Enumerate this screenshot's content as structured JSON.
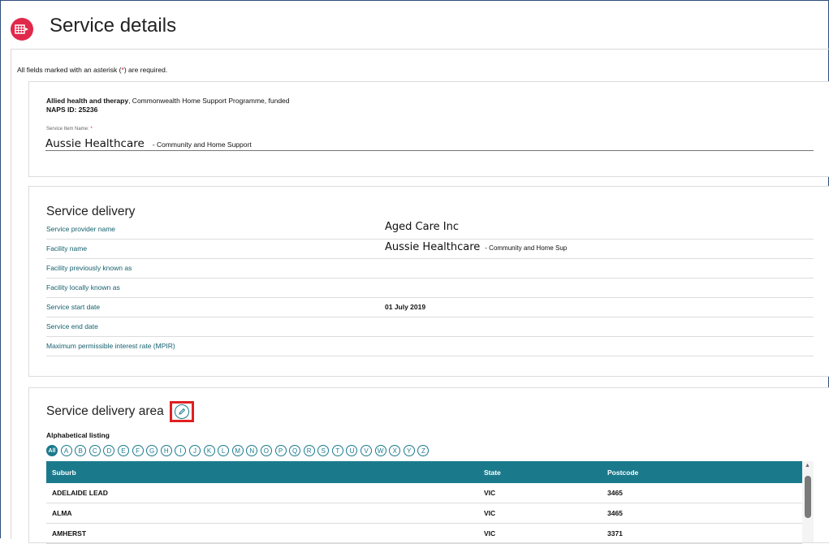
{
  "page": {
    "title": "Service details",
    "required_note_pre": "All fields marked with an asterisk (",
    "required_note_star": "*",
    "required_note_post": ") are required."
  },
  "service": {
    "type_bold": "Allied health and therapy",
    "type_rest": ", Commonwealth Home Support Programme, funded",
    "naps": "NAPS ID: 25236",
    "item_name_label": "Service Item Name:",
    "item_name_star": "*",
    "item_name_main": "Aussie Healthcare",
    "item_name_suffix": "- Community and Home Support"
  },
  "delivery": {
    "title": "Service delivery",
    "rows": [
      {
        "label": "Service provider name",
        "value": "Aged Care Inc"
      },
      {
        "label": "Facility name",
        "value": "Aussie Healthcare",
        "value_suffix": "- Community and Home Sup"
      },
      {
        "label": "Facility previously known as",
        "value": ""
      },
      {
        "label": "Facility locally known as",
        "value": ""
      },
      {
        "label": "Service start date",
        "value": "01 July 2019"
      },
      {
        "label": "Service end date",
        "value": ""
      },
      {
        "label": "Maximum permissible interest rate (MPIR)",
        "value": ""
      }
    ]
  },
  "area": {
    "title": "Service delivery area",
    "alpha_label": "Alphabetical listing",
    "letters": [
      "All",
      "A",
      "B",
      "C",
      "D",
      "E",
      "F",
      "G",
      "H",
      "I",
      "J",
      "K",
      "L",
      "M",
      "N",
      "O",
      "P",
      "Q",
      "R",
      "S",
      "T",
      "U",
      "V",
      "W",
      "X",
      "Y",
      "Z"
    ],
    "columns": [
      "Suburb",
      "State",
      "Postcode"
    ],
    "rows": [
      [
        "ADELAIDE LEAD",
        "VIC",
        "3465"
      ],
      [
        "ALMA",
        "VIC",
        "3465"
      ],
      [
        "AMHERST",
        "VIC",
        "3371"
      ]
    ]
  },
  "colors": {
    "accent": "#1a7a8c",
    "app_icon": "#e0294b",
    "highlight": "#e02020",
    "label_text": "#15606e"
  },
  "icons": {
    "app": "service-grid-icon",
    "edit": "pencil-icon",
    "scroll_up": "chevron-up-icon"
  }
}
